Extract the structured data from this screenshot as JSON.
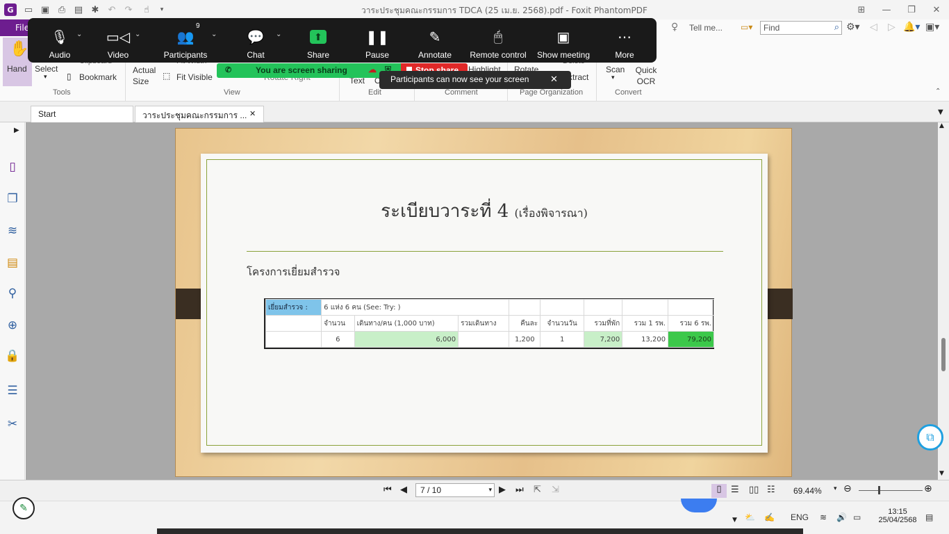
{
  "app": {
    "window_title": "วาระประชุมคณะกรรมการ TDCA (25 เม.ย. 2568).pdf - Foxit PhantomPDF"
  },
  "ribbon": {
    "file_tab": "File",
    "tell_me": "Tell me...",
    "find_placeholder": "Find",
    "buttons": {
      "hand": "Hand",
      "select": "Select",
      "clipboard": "Clipboard",
      "bookmark": "Bookmark",
      "actual_size": "Actual Size",
      "fit_width": "Fit Width",
      "fit_visible": "Fit Visible",
      "rotate_right": "Rotate Right",
      "text": "Text",
      "object": "Obj",
      "highlight": "Highlight",
      "rotate": "Rotate",
      "delete": "Delete",
      "extract": "Extract",
      "scan": "Scan",
      "quick_ocr": "Quick OCR"
    },
    "groups": {
      "tools": "Tools",
      "view": "View",
      "edit": "Edit",
      "comment": "Comment",
      "page_organization": "Page Organization",
      "convert": "Convert"
    }
  },
  "zoom": {
    "toolbar": [
      {
        "label": "Audio",
        "icon": "microphone-icon"
      },
      {
        "label": "Video",
        "icon": "video-camera-icon"
      },
      {
        "label": "Participants",
        "icon": "participants-icon",
        "badge": "9"
      },
      {
        "label": "Chat",
        "icon": "chat-icon"
      },
      {
        "label": "Share",
        "icon": "share-arrow-icon"
      },
      {
        "label": "Pause",
        "icon": "pause-icon"
      },
      {
        "label": "Annotate",
        "icon": "pencil-icon"
      },
      {
        "label": "Remote control",
        "icon": "mouse-icon"
      },
      {
        "label": "Show meeting",
        "icon": "meeting-window-icon"
      },
      {
        "label": "More",
        "icon": "more-dots-icon"
      }
    ],
    "share_banner": "You are screen sharing",
    "stop_share": "Stop share",
    "toast": "Participants can now see your screen"
  },
  "tabs": {
    "start": "Start",
    "document": "วาระประชุมคณะกรรมการ ..."
  },
  "slide": {
    "title_main": "ระเบียบวาระที่ 4",
    "title_sub": "(เรื่องพิจารณา)",
    "heading": "โครงการเยี่ยมสำรวจ",
    "sheet": {
      "row1_label": "เยี่ยมสำรวจ :",
      "row1_text": "6 แห่ง  6 คน (See:   Try:     )",
      "headers": [
        "จำนวน",
        "เดินทาง/คน (1,000 บาท)",
        "รวมเดินทาง",
        "คืนละ",
        "จำนวนวัน",
        "รวมที่พัก",
        "รวม 1 รพ.",
        "รวม 6 รพ."
      ],
      "values": [
        "6",
        "6,000",
        "",
        "1,200",
        "1",
        "7,200",
        "13,200",
        "79,200"
      ]
    }
  },
  "statusbar": {
    "page_indicator": "7 / 10",
    "zoom_level": "69.44%"
  },
  "taskbar": {
    "language": "ENG",
    "time": "13:15",
    "date": "25/04/2568"
  }
}
